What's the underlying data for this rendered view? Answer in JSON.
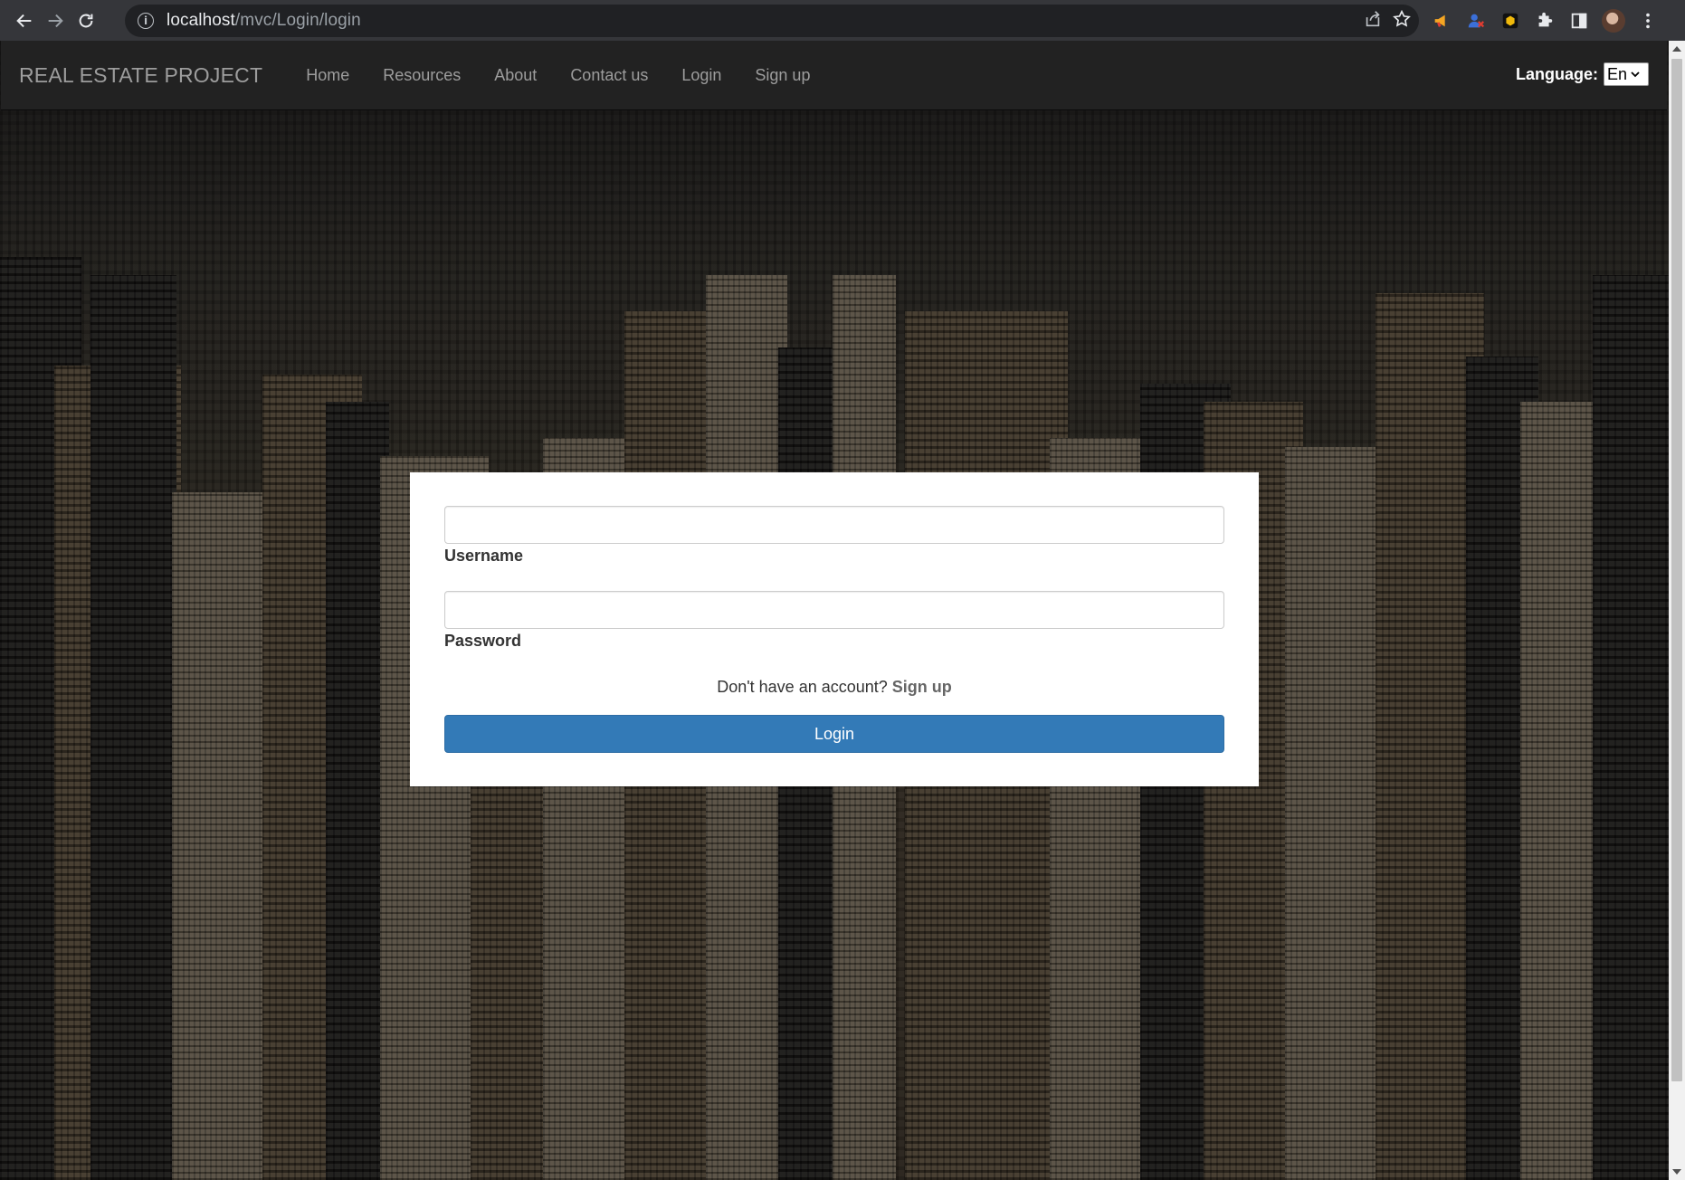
{
  "browser": {
    "url_host": "localhost",
    "url_path": "/mvc/Login/login"
  },
  "navbar": {
    "brand": "REAL ESTATE PROJECT",
    "links": [
      "Home",
      "Resources",
      "About",
      "Contact us",
      "Login",
      "Sign up"
    ],
    "language_label": "Language:",
    "language_value": "En"
  },
  "login_form": {
    "username_label": "Username",
    "password_label": "Password",
    "signup_prompt": "Don't have an account?",
    "signup_link": "Sign up",
    "submit_label": "Login"
  },
  "colors": {
    "navbar_bg": "#222222",
    "navbar_text": "#9d9d9d",
    "primary_button": "#337ab7"
  }
}
